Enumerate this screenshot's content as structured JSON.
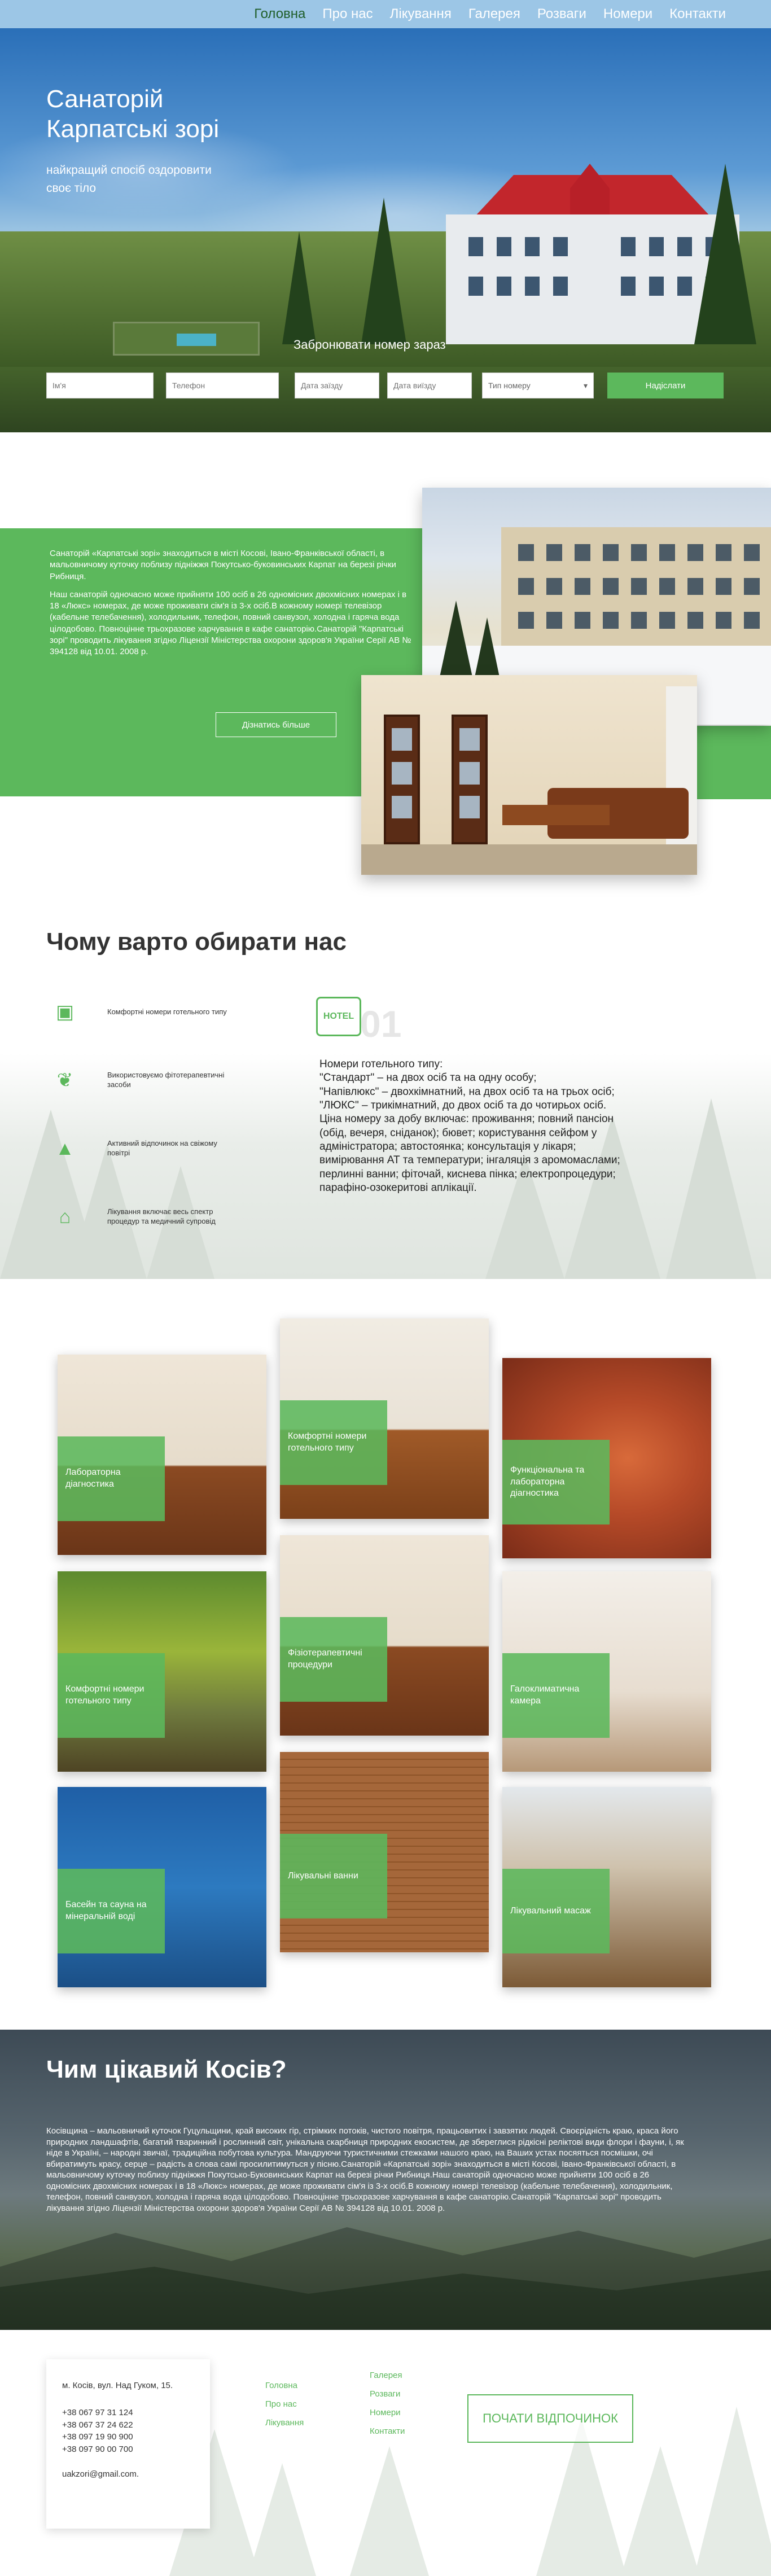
{
  "nav": {
    "items": [
      "Головна",
      "Про нас",
      "Лікування",
      "Галерея",
      "Розваги",
      "Номери",
      "Контакти"
    ],
    "active_index": 0
  },
  "hero": {
    "title": "Санаторій Карпатські зорі",
    "tagline": "найкращий спосіб оздоровити своє тіло",
    "booking_title": "Забронювати номер зараз",
    "fields": {
      "name_placeholder": "Ім'я",
      "phone_placeholder": "Телефон",
      "checkin_placeholder": "Дата заїзду",
      "checkout_placeholder": "Дата виїзду",
      "room_type": "Тип номеру"
    },
    "submit_label": "Надіслати"
  },
  "about": {
    "paragraph1": "Санаторій «Карпатські зорі» знаходиться в місті Косові, Івано-Франківської області, в мальовничому куточку поблизу підніжжя Покутсько-буковинських Карпат на березі річки Рибниця.",
    "paragraph2": "Наш санаторій одночасно може прийняти 100 осіб в 26 одномісних двохмісних номерах і в 18 «Люкс» номерах, де може проживати сім'я із 3-х осіб.В кожному номері телевізор (кабельне телебачення), холодильник, телефон, повний санвузол, холодна і гаряча вода цілодобово. Повноцінне трьохразове харчування в кафе санаторію.Санаторій \"Карпатські зорі\" проводить лікування згідно Ліцензії Міністерства охорони здоров'я України Серії АВ № 394128 від 10.01. 2008 р.",
    "more_label": "Дізнатись більше"
  },
  "why": {
    "title": "Чому варто обирати нас",
    "features": [
      {
        "icon": "hotel-icon",
        "text": "Комфортні номери готельного типу"
      },
      {
        "icon": "leaves-icon",
        "text": "Використовуємо фітотерапевтичні засоби"
      },
      {
        "icon": "mountains-icon",
        "text": "Активний відпочинок на свіжому повітрі"
      },
      {
        "icon": "basket-icon",
        "text": "Лікування включає весь спектр процедур та медичний супровід"
      }
    ],
    "badge_icon": "hotel-sign-icon",
    "badge_text": "HOTEL",
    "counter": "01",
    "rooms_text": [
      "Номери готельного типу:",
      "\"Стандарт\" – на двох осіб та на одну особу;",
      "\"Напівлюкс\" – двохкімнатний, на двох осіб та на трьох осіб;",
      "\"ЛЮКС\" – трикімнатний, до двох осіб та до чотирьох осіб.",
      "Ціна номеру за добу включає: проживання; повний пансіон (обід, вечеря, сніданок); бювет; користування сейфом у адміністратора; автостоянка; консультація у лікаря; вимірювання АТ та температури; інгаляція з аромомаслами; перлинні ванни; фіточай, киснева пінка; електропроцедури; парафіно-озокеритові аплікації."
    ]
  },
  "gallery": {
    "items": [
      {
        "label": "Лабораторна діагностика"
      },
      {
        "label": "Комфортні номери готельного типу"
      },
      {
        "label": "Функціональна та лабораторна діагностика"
      },
      {
        "label": "Комфортні номери готельного типу"
      },
      {
        "label": "Фізіотерапевтичні процедури"
      },
      {
        "label": "Галоклиматична камера"
      },
      {
        "label": "Басейн та сауна на мінеральній воді"
      },
      {
        "label": "Лікувальні ванни"
      },
      {
        "label": "Лікувальний масаж"
      }
    ]
  },
  "kosiv": {
    "title": "Чим цікавий Косів?",
    "text": "Косівщина – мальовничий куточок Гуцульщини, край високих гір, стрімких потоків, чистого повітря, працьовитих і завзятих людей. Своєрідність краю, краса його природних ландшафтів, багатий тваринний і рослинний світ, унікальна скарбниця природних екосистем, де збереглися рідкісні реліктові види флори і фауни, і, як ніде в Україні, – народні звичаї, традиційна побутова культура. Мандруючи туристичними стежками нашого краю, на Ваших устах посяяться посмішки, очі вбиратимуть красу, серце – радість а слова самі просилитимуться у пісню.Санаторій «Карпатські зорі» знаходиться в місті Косові, Івано-Франківської області, в мальовничому куточку поблизу підніжжя Покутсько-Буковинських Карпат на березі річки Рибниця.Наш санаторій одночасно може прийняти 100 осіб в 26 одномісних двохмісних номерах і в 18 «Люкс» номерах, де може проживати сім'я із 3-х осіб.В кожному номері телевізор (кабельне телебачення), холодильник, телефон, повний санвузол, холодна і гаряча вода цілодобово. Повноцінне трьохразове харчування в кафе санаторію.Санаторій \"Карпатські зорі\" проводить лікування згідно Ліцензії Міністерства охорони здоров'я України Серії АВ № 394128 від 10.01. 2008 р."
  },
  "footer": {
    "address": "м. Косів, вул. Над Гуком, 15.",
    "phones": [
      "+38 067 97 31 124",
      "+38 067 37 24 622",
      "+38 097 19 90 900",
      "+38 097 90 00 700"
    ],
    "email": "uakzori@gmail.com.",
    "col1": [
      "Головна",
      "Про нас",
      "Лікування"
    ],
    "col2": [
      "Галерея",
      "Розваги",
      "Номери",
      "Контакти"
    ],
    "cta_label": "ПОЧАТИ ВІДПОЧИНОК"
  }
}
